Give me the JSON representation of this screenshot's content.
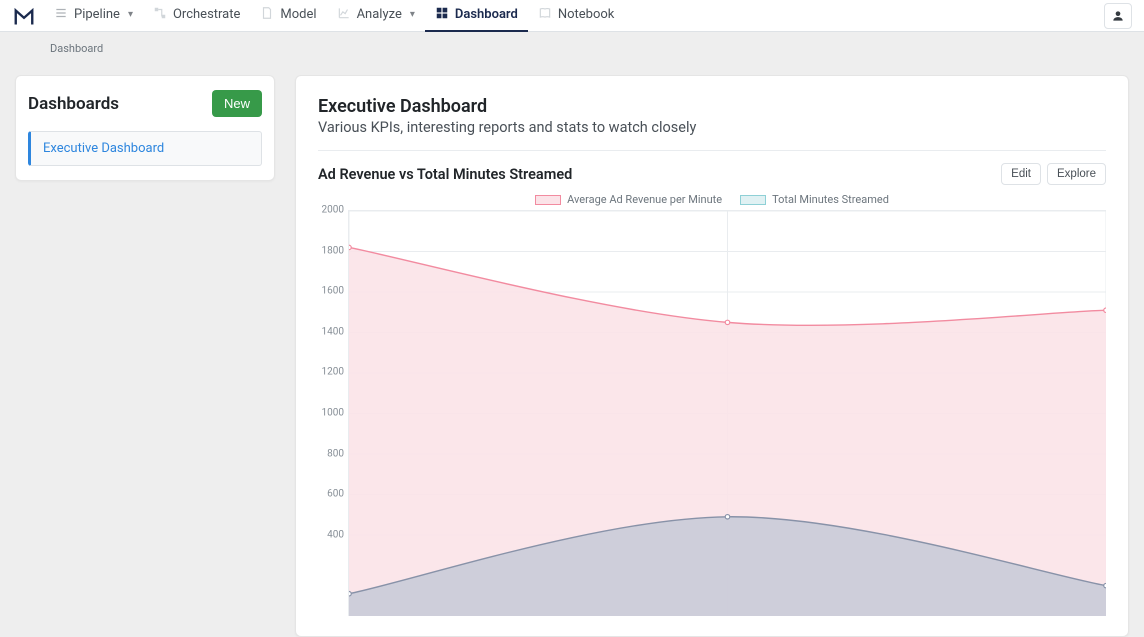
{
  "nav": {
    "items": [
      {
        "label": "Pipeline",
        "icon": "list-icon",
        "dropdown": true
      },
      {
        "label": "Orchestrate",
        "icon": "flow-icon",
        "dropdown": false
      },
      {
        "label": "Model",
        "icon": "doc-icon",
        "dropdown": false
      },
      {
        "label": "Analyze",
        "icon": "chart-line-icon",
        "dropdown": true
      },
      {
        "label": "Dashboard",
        "icon": "grid-icon",
        "dropdown": false
      },
      {
        "label": "Notebook",
        "icon": "book-icon",
        "dropdown": false
      }
    ],
    "active": "Dashboard"
  },
  "breadcrumb": "Dashboard",
  "sidebar": {
    "title": "Dashboards",
    "new_label": "New",
    "items": [
      {
        "label": "Executive Dashboard"
      }
    ]
  },
  "content": {
    "title": "Executive Dashboard",
    "subtitle": "Various KPIs, interesting reports and stats to watch closely",
    "chart_title": "Ad Revenue vs Total Minutes Streamed",
    "actions": {
      "edit": "Edit",
      "explore": "Explore"
    }
  },
  "chart_data": {
    "type": "area",
    "x": [
      0,
      1,
      2
    ],
    "series": [
      {
        "name": "Average Ad Revenue per Minute",
        "values": [
          1820,
          1450,
          1510
        ],
        "color_fill": "#fbe3e8",
        "color_stroke": "#f28ba0"
      },
      {
        "name": "Total Minutes Streamed",
        "values": [
          110,
          490,
          150
        ],
        "color_fill": "#bfc6d4",
        "color_stroke": "#8892a8"
      }
    ],
    "title": "Ad Revenue vs Total Minutes Streamed",
    "ylim": [
      0,
      2000
    ],
    "y_ticks": [
      2000,
      1800,
      1600,
      1400,
      1200,
      1000,
      800,
      600,
      400
    ],
    "xlabel": "",
    "ylabel": ""
  }
}
